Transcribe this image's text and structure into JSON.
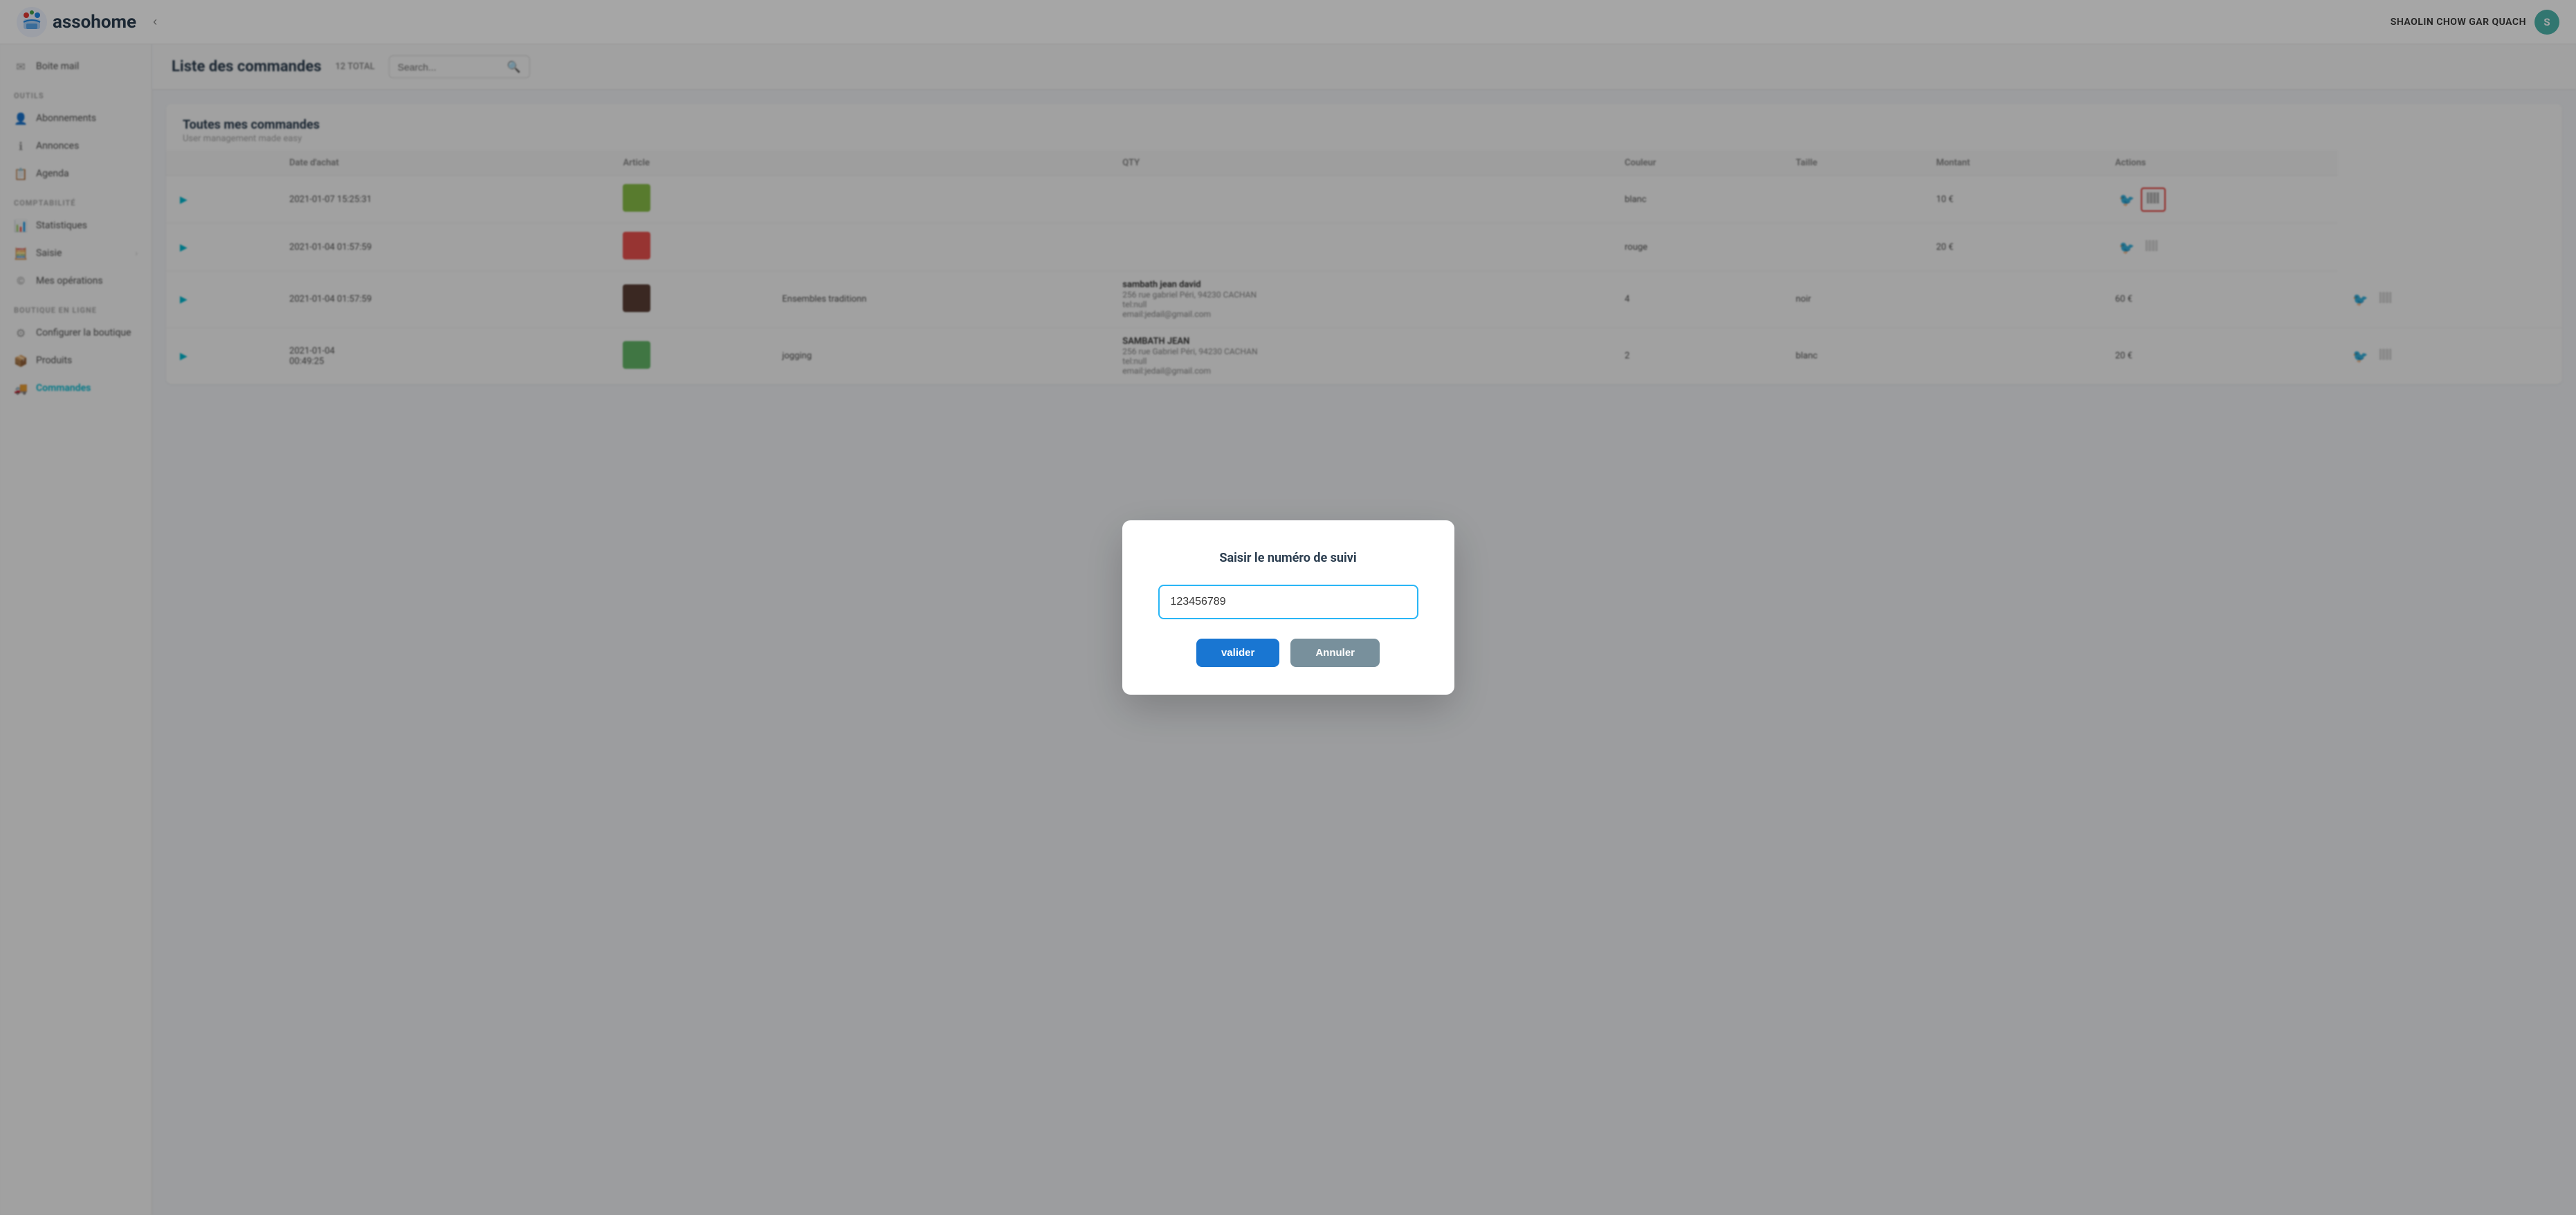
{
  "app": {
    "name": "assohome",
    "collapse_btn": "‹"
  },
  "user": {
    "name": "SHAOLIN CHOW GAR QUACH",
    "avatar_letter": "S"
  },
  "sidebar": {
    "boite_mail_label": "Boite mail",
    "sections": [
      {
        "id": "outils",
        "label": "OUTILS",
        "items": [
          {
            "id": "abonnements",
            "label": "Abonnements",
            "icon": "👤"
          },
          {
            "id": "annonces",
            "label": "Annonces",
            "icon": "ℹ️"
          },
          {
            "id": "agenda",
            "label": "Agenda",
            "icon": "📋"
          }
        ]
      },
      {
        "id": "comptabilite",
        "label": "COMPTABILITÉ",
        "items": [
          {
            "id": "statistiques",
            "label": "Statistiques",
            "icon": "📊"
          },
          {
            "id": "saisie",
            "label": "Saisie",
            "icon": "🧮",
            "arrow": "›"
          },
          {
            "id": "mes-operations",
            "label": "Mes opérations",
            "icon": "©"
          }
        ]
      },
      {
        "id": "boutique",
        "label": "BOUTIQUE EN LIGNE",
        "items": [
          {
            "id": "configurer",
            "label": "Configurer la boutique",
            "icon": "⚙️"
          },
          {
            "id": "produits",
            "label": "Produits",
            "icon": "📦"
          },
          {
            "id": "commandes",
            "label": "Commandes",
            "icon": "🚚",
            "active": true
          }
        ]
      }
    ]
  },
  "page_header": {
    "title": "Liste des commandes",
    "total_label": "12 TOTAL",
    "search_placeholder": "Search..."
  },
  "table": {
    "section_title": "Toutes mes commandes",
    "section_subtitle": "User management made easy",
    "columns": [
      "Date d'achat",
      "Article",
      "",
      "",
      "QTY",
      "Couleur",
      "Taille",
      "Montant",
      "Actions"
    ],
    "rows": [
      {
        "date": "2021-01-07 15:25:31",
        "article_img": true,
        "article_img_bg": "#8bc34a",
        "customer_name": "",
        "customer_address": "",
        "customer_tel": "",
        "customer_email": "",
        "qty": "",
        "couleur": "blanc",
        "taille": "",
        "montant": "10 €",
        "barcode_highlighted": true
      },
      {
        "date": "2021-01-04 01:57:59",
        "article_img": true,
        "article_img_bg": "#ef5350",
        "customer_name": "",
        "customer_address": "",
        "customer_tel": "",
        "customer_email": "",
        "qty": "",
        "couleur": "rouge",
        "taille": "",
        "montant": "20 €",
        "barcode_highlighted": false
      },
      {
        "date": "2021-01-04 01:57:59",
        "article_img": true,
        "article_img_bg": "#5d4037",
        "article_label": "Ensembles traditionn",
        "customer_name": "sambath jean david",
        "customer_address": "256 rue gabriel Péri, 94230 CACHAN",
        "customer_tel": "tel:null",
        "customer_email": "email:jedail@gmail.com",
        "qty": "4",
        "couleur": "noir",
        "taille": "",
        "montant": "60 €",
        "barcode_highlighted": false
      },
      {
        "date": "2021-01-04 00:49:25",
        "article_img": true,
        "article_img_bg": "#66bb6a",
        "article_label": "jogging",
        "customer_name": "SAMBATH JEAN",
        "customer_address": "256 rue Gabriel Péri, 94230 CACHAN",
        "customer_tel": "tel:null",
        "customer_email": "email:jedail@gmail.com",
        "qty": "2",
        "couleur": "blanc",
        "taille": "",
        "montant": "20 €",
        "barcode_highlighted": false
      }
    ]
  },
  "modal": {
    "title": "Saisir le numéro de suivi",
    "input_value": "123456789",
    "input_placeholder": "",
    "valider_label": "valider",
    "annuler_label": "Annuler"
  }
}
